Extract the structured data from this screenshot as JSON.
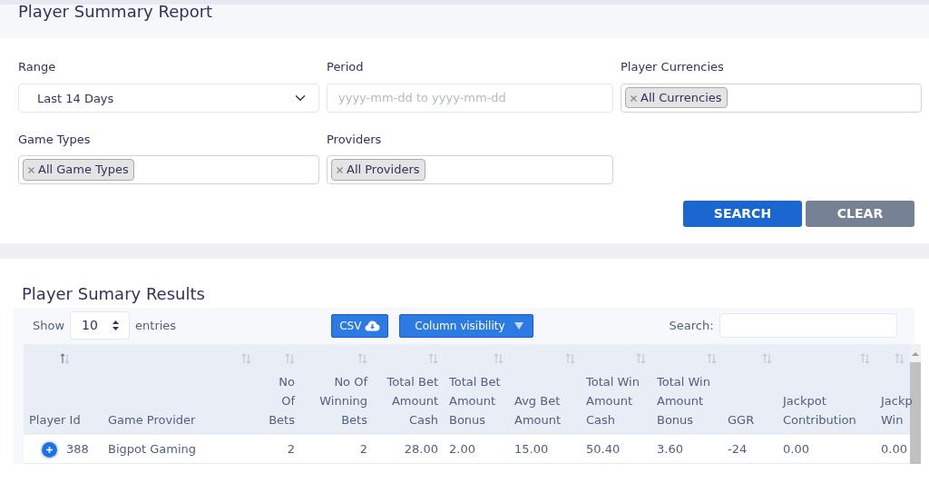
{
  "page_title": "Player Summary Report",
  "filters": [
    {
      "kind": "select",
      "label": "Range",
      "value": "Last 14 Days"
    },
    {
      "kind": "text",
      "label": "Period",
      "placeholder": "yyyy-mm-dd to yyyy-mm-dd"
    },
    {
      "kind": "tags",
      "label": "Player Currencies",
      "tags": [
        "All Currencies"
      ]
    },
    {
      "kind": "tags",
      "label": "Game Types",
      "tags": [
        "All Game Types"
      ]
    },
    {
      "kind": "tags",
      "label": "Providers",
      "tags": [
        "All Providers"
      ]
    }
  ],
  "buttons": [
    {
      "kind": "primary",
      "label": "SEARCH"
    },
    {
      "kind": "secondary",
      "label": "CLEAR"
    }
  ],
  "results": {
    "title": "Player Sumary Results",
    "show_label": "Show",
    "page_size": "10",
    "entries_label": "entries",
    "csv_label": "CSV",
    "column_visibility_label": "Column visibility",
    "search_label": "Search:",
    "columns": [
      {
        "label": "Player Id",
        "right_aligned": false,
        "sorted": true
      },
      {
        "label": "Game Provider",
        "right_aligned": false,
        "sorted": false
      },
      {
        "label": "No Of Bets",
        "right_aligned": true,
        "sorted": false
      },
      {
        "label": "No Of Winning Bets",
        "right_aligned": true,
        "sorted": false
      },
      {
        "label": "Total Bet Amount Cash",
        "right_aligned": true,
        "sorted": false
      },
      {
        "label": "Total Bet Amount Bonus",
        "right_aligned": false,
        "sorted": false
      },
      {
        "label": "Avg Bet Amount",
        "right_aligned": false,
        "sorted": false
      },
      {
        "label": "Total Win Amount Cash",
        "right_aligned": false,
        "sorted": false
      },
      {
        "label": "Total Win Amount Bonus",
        "right_aligned": false,
        "sorted": false
      },
      {
        "label": "GGR",
        "right_aligned": false,
        "sorted": false
      },
      {
        "label": "Jackpot Contribution",
        "right_aligned": false,
        "sorted": false
      },
      {
        "label": "Jackp Win",
        "right_aligned": false,
        "sorted": false
      }
    ],
    "rows": [
      [
        "388",
        "Bigpot Gaming",
        "2",
        "2",
        "28.00",
        "2.00",
        "15.00",
        "50.40",
        "3.60",
        "-24",
        "0.00",
        "0.00"
      ]
    ]
  }
}
